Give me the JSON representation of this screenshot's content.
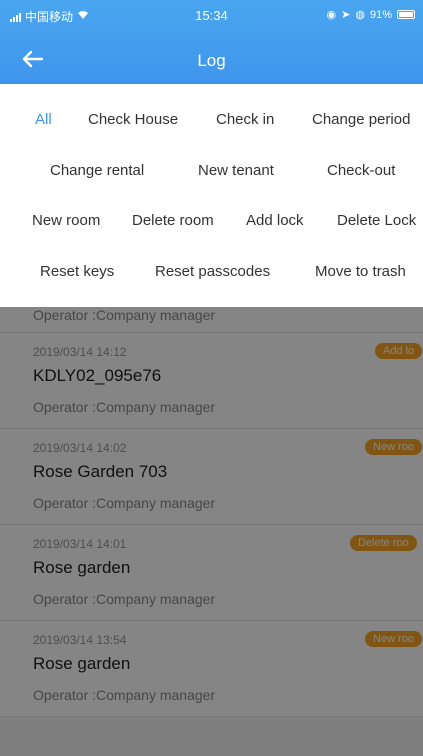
{
  "status_bar": {
    "carrier": "中国移动",
    "time": "15:34",
    "battery": "91%"
  },
  "nav": {
    "title": "Log",
    "back_icon": "arrow-left-icon"
  },
  "filters": {
    "selected": "All",
    "items": [
      "All",
      "Check House",
      "Check in",
      "Change period",
      "Change rental",
      "New tenant",
      "Check-out",
      "New room",
      "Delete room",
      "Add lock",
      "Delete Lock",
      "Reset keys",
      "Reset passcodes",
      "Move to trash"
    ]
  },
  "list": {
    "partial_operator": "Operator :Company manager",
    "records": [
      {
        "time": "2019/03/14 14:12",
        "room": "KDLY02_095e76",
        "operator": "Operator :Company manager",
        "badge": "Add lo"
      },
      {
        "time": "2019/03/14 14:02",
        "room": "Rose Garden 703",
        "operator": "Operator :Company manager",
        "badge": "New roo"
      },
      {
        "time": "2019/03/14 14:01",
        "room": "Rose garden",
        "operator": "Operator :Company manager",
        "badge": "Delete roo"
      },
      {
        "time": "2019/03/14 13:54",
        "room": "Rose garden",
        "operator": "Operator :Company manager",
        "badge": "New roo"
      }
    ]
  },
  "colors": {
    "accent": "#3f95ec",
    "badge": "#f5a623",
    "overlay": "rgba(0,0,0,0.48)"
  }
}
